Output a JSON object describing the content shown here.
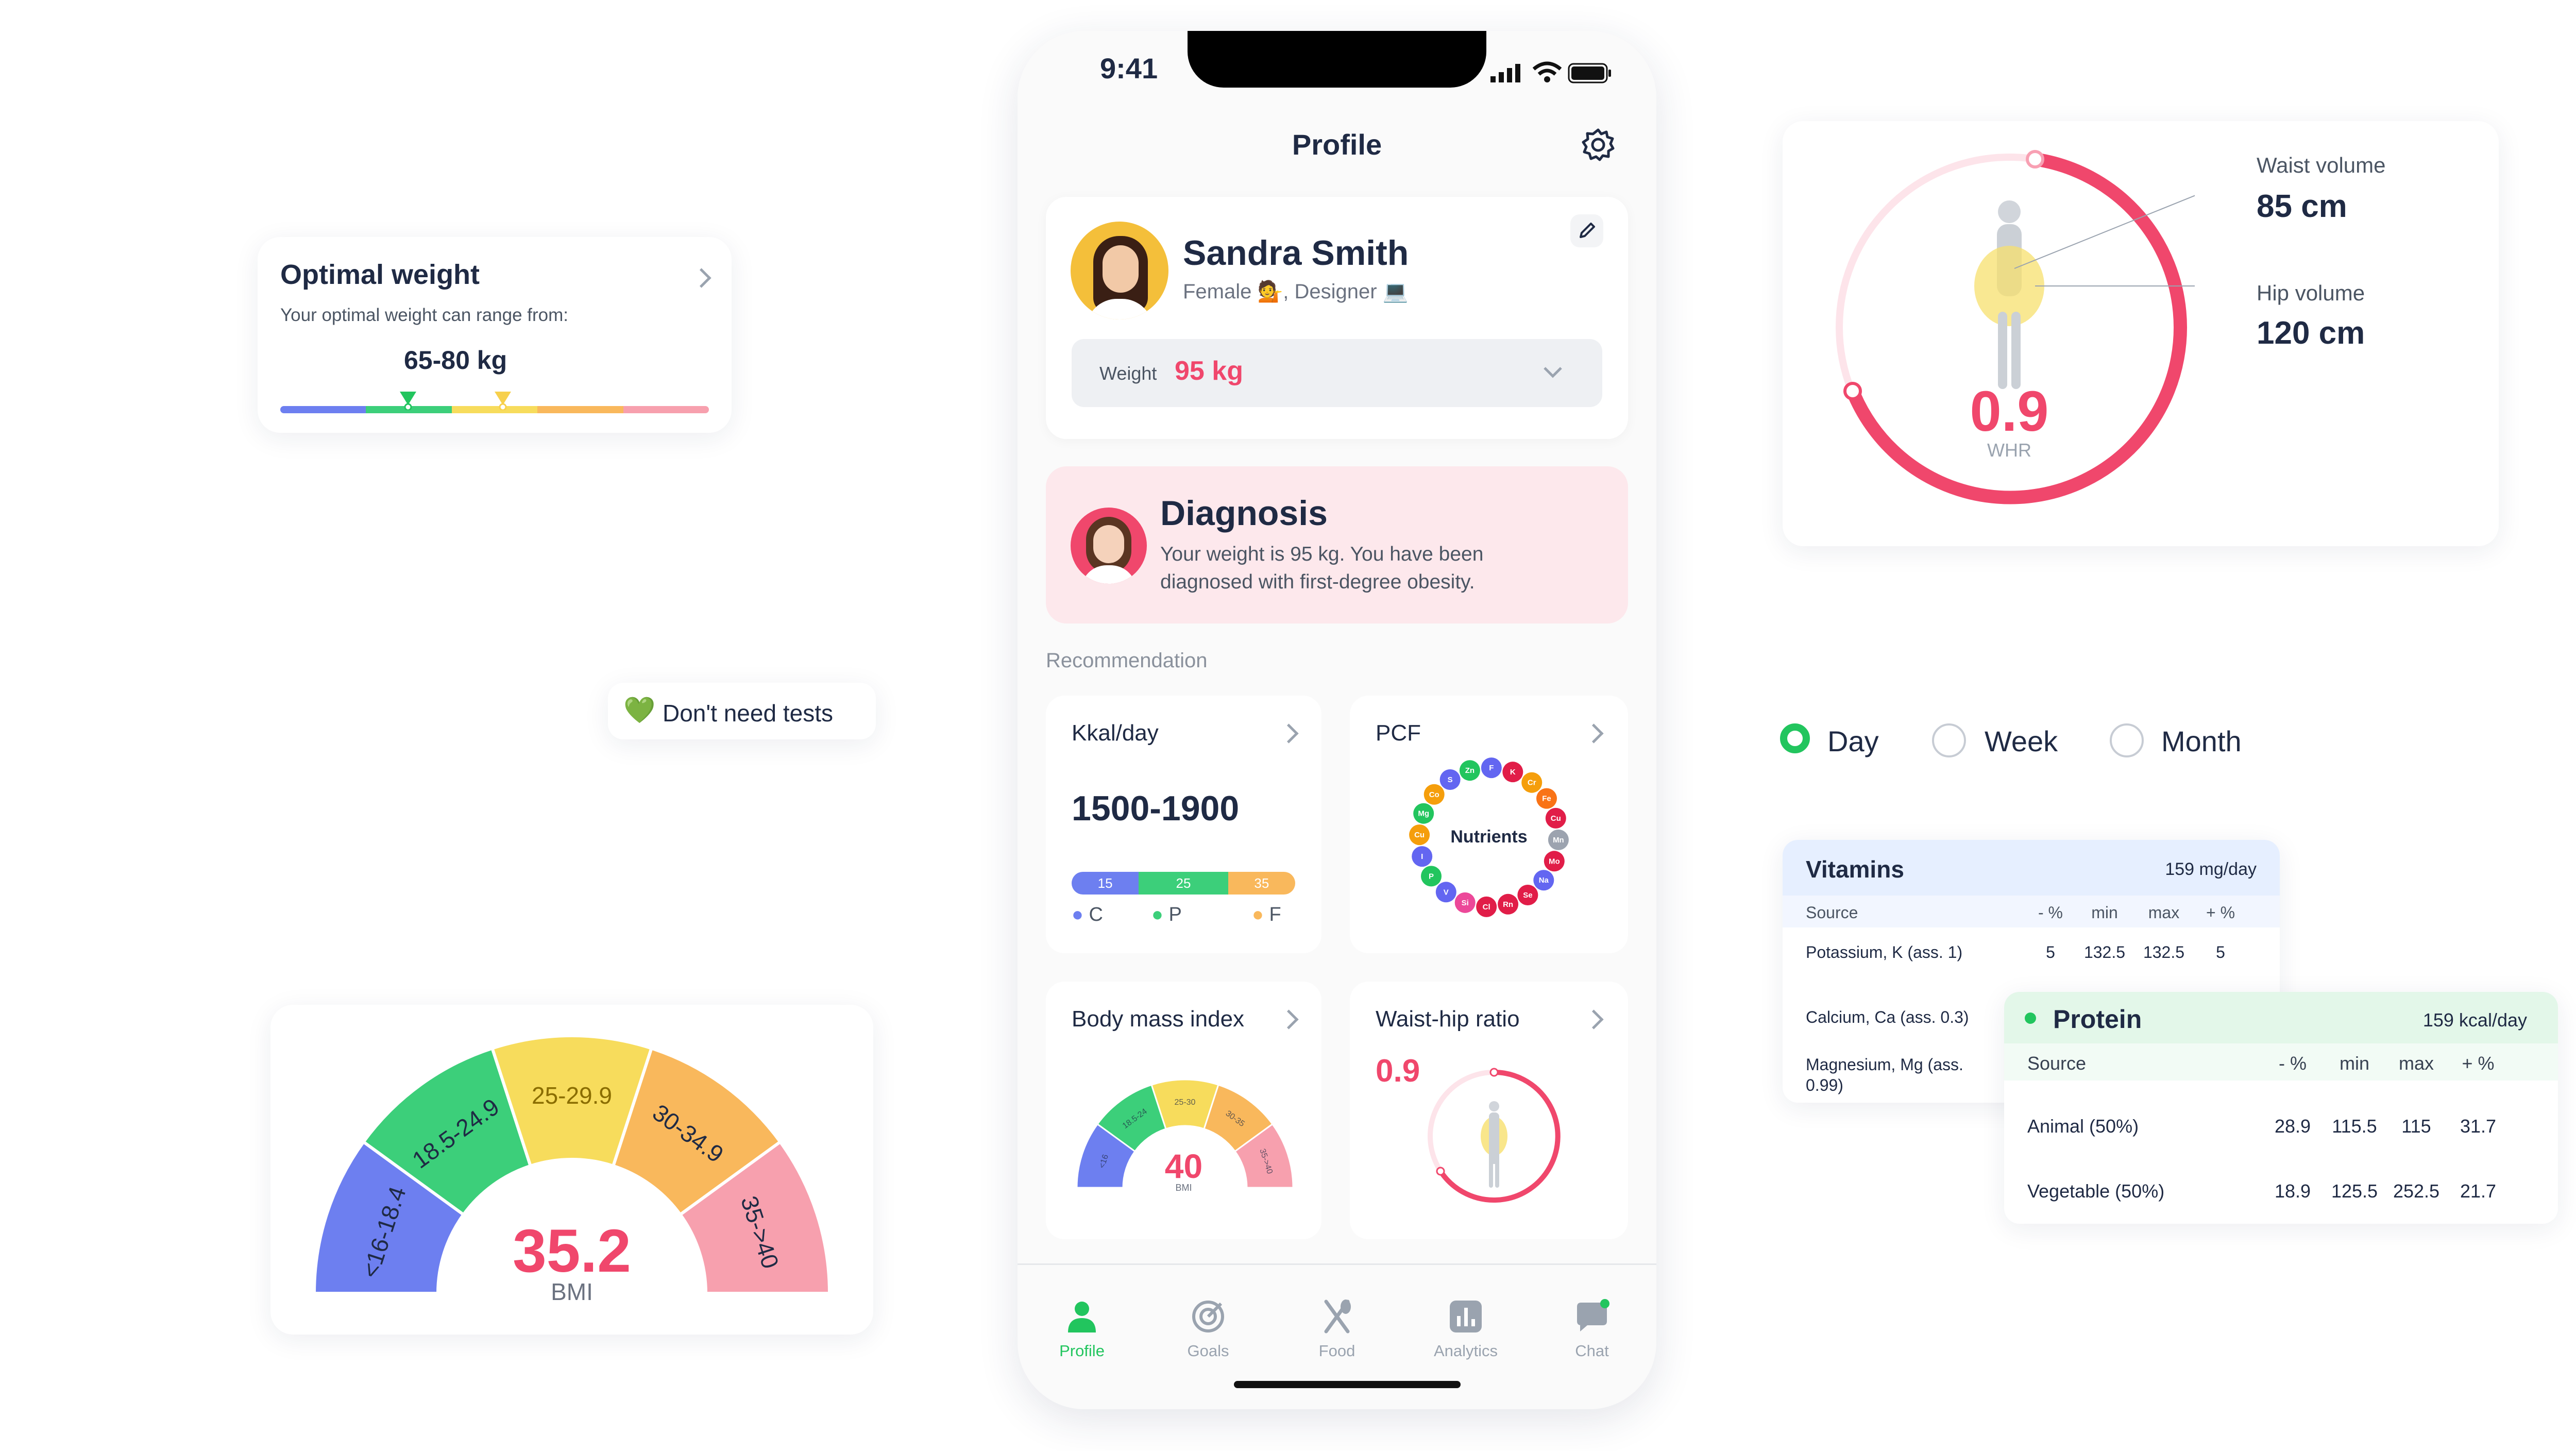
{
  "optimal_weight": {
    "title": "Optimal weight",
    "subtitle": "Your optimal weight can range from:",
    "range": "65-80 kg",
    "scale_colors": [
      "#6d7ff0",
      "#3ccf7a",
      "#f7dc5c",
      "#f9b85c",
      "#f7a0ae"
    ]
  },
  "tests_badge": {
    "label": "Don't need tests",
    "icon": "green-heart-icon"
  },
  "bmi_gauge": {
    "value": "35.2",
    "unit": "BMI",
    "segments": [
      {
        "label": "<16-18.4",
        "color": "#6d7ff0"
      },
      {
        "label": "18.5-24.9",
        "color": "#3ccf7a"
      },
      {
        "label": "25-29.9",
        "color": "#f7dc5c"
      },
      {
        "label": "30-34.9",
        "color": "#f9b85c"
      },
      {
        "label": "35->40",
        "color": "#f7a0ae"
      }
    ]
  },
  "phone": {
    "status_time": "9:41",
    "header_title": "Profile",
    "profile": {
      "name": "Sandra Smith",
      "meta": "Female 💁, Designer 💻",
      "weight_label": "Weight",
      "weight_value": "95 kg"
    },
    "diagnosis": {
      "title": "Diagnosis",
      "text": "Your weight is 95 kg. You have been diagnosed with first-degree obesity."
    },
    "recommendation_label": "Recommendation",
    "kcal": {
      "title": "Kkal/day",
      "value": "1500-1900",
      "bars": [
        {
          "value": "15",
          "color": "#6d7ff0"
        },
        {
          "value": "25",
          "color": "#3ccf7a"
        },
        {
          "value": "35",
          "color": "#f9b85c"
        }
      ],
      "legend": [
        {
          "label": "C",
          "color": "#6d7ff0"
        },
        {
          "label": "P",
          "color": "#3ccf7a"
        },
        {
          "label": "F",
          "color": "#f9b85c"
        }
      ]
    },
    "pcf": {
      "title": "PCF",
      "center_label": "Nutrients",
      "nutrients": [
        "K",
        "Cr",
        "Fe",
        "Cu",
        "Mn",
        "Mo",
        "Na",
        "Se",
        "Rn",
        "Cl",
        "Si",
        "V",
        "P",
        "I",
        "Cu",
        "Mg",
        "Co",
        "S",
        "Zn",
        "F"
      ]
    },
    "bmi_card": {
      "title": "Body mass index",
      "value": "40",
      "unit": "BMI",
      "labels": [
        "<16",
        "18.5-24",
        "25-30",
        "30-35",
        "35->40"
      ]
    },
    "whr_card": {
      "title": "Waist-hip ratio",
      "value": "0.9"
    },
    "tabs": [
      {
        "label": "Profile",
        "icon": "person-icon",
        "active": true
      },
      {
        "label": "Goals",
        "icon": "target-icon",
        "active": false
      },
      {
        "label": "Food",
        "icon": "fork-knife-icon",
        "active": false
      },
      {
        "label": "Analytics",
        "icon": "bar-chart-icon",
        "active": false
      },
      {
        "label": "Chat",
        "icon": "chat-icon",
        "active": false
      }
    ]
  },
  "whr_panel": {
    "waist_label": "Waist volume",
    "waist_value": "85 cm",
    "hip_label": "Hip volume",
    "hip_value": "120 cm",
    "ratio": "0.9",
    "ratio_label": "WHR"
  },
  "period": {
    "options": [
      "Day",
      "Week",
      "Month"
    ],
    "selected": "Day"
  },
  "vitamins": {
    "title": "Vitamins",
    "total": "159 mg/day",
    "headers": [
      "Source",
      "- %",
      "min",
      "max",
      "+ %"
    ],
    "rows": [
      [
        "Potassium, K (ass. 1)",
        "5",
        "132.5",
        "132.5",
        "5"
      ],
      [
        "Calcium, Ca (ass. 0.3)",
        "",
        "",
        "",
        ""
      ],
      [
        "Magnesium, Mg (ass. 0.99)",
        "",
        "",
        "",
        ""
      ]
    ]
  },
  "protein": {
    "title": "Protein",
    "total": "159 kcal/day",
    "headers": [
      "Source",
      "- %",
      "min",
      "max",
      "+ %"
    ],
    "rows": [
      [
        "Animal (50%)",
        "28.9",
        "115.5",
        "115",
        "31.7"
      ],
      [
        "Vegetable (50%)",
        "18.9",
        "125.5",
        "252.5",
        "21.7"
      ]
    ]
  }
}
